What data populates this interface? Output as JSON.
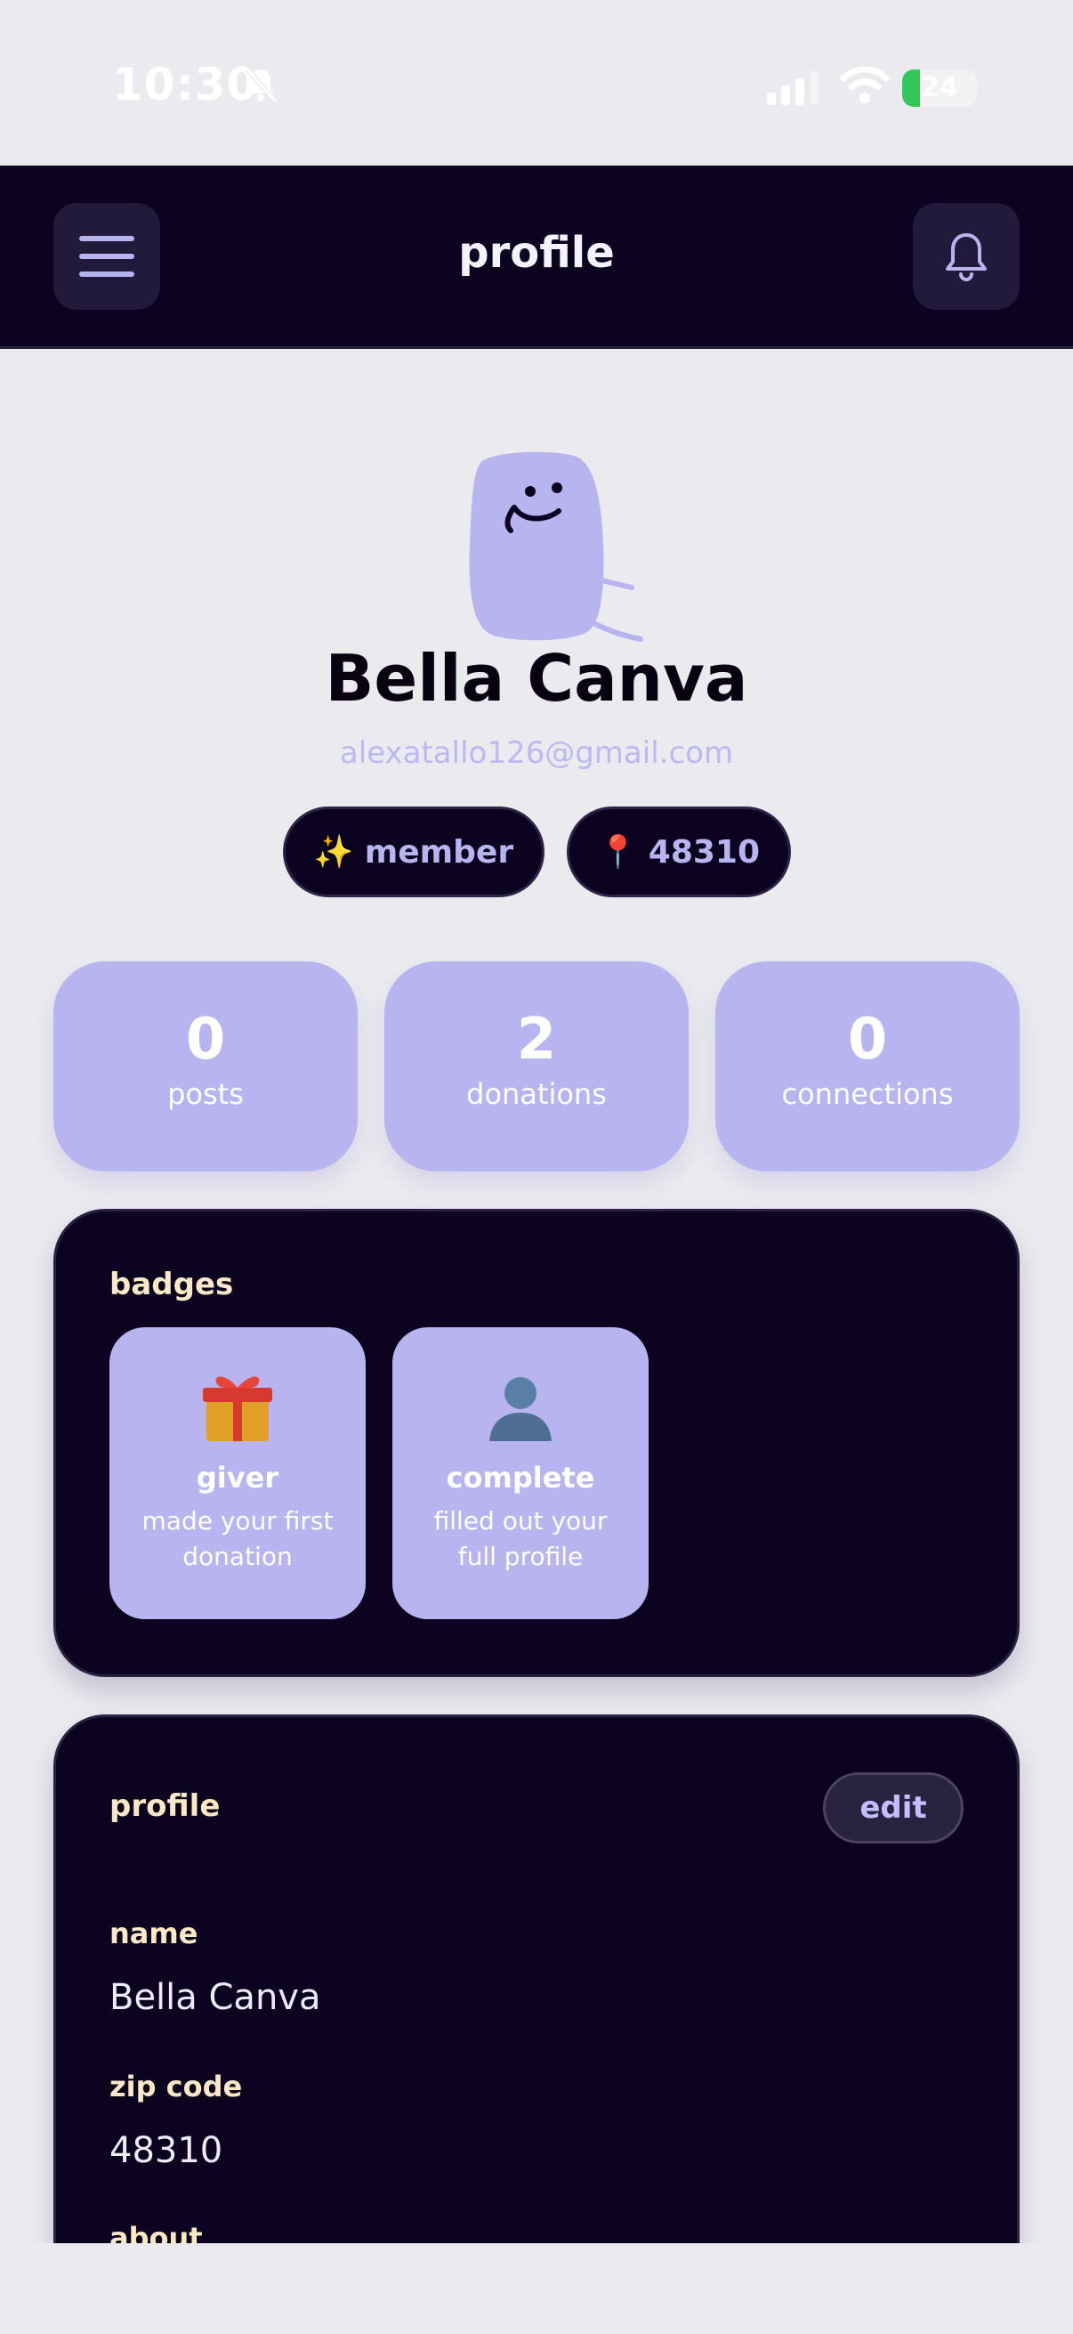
{
  "status_bar": {
    "time": "10:30",
    "battery": "24",
    "battery_level": 0.24
  },
  "header": {
    "title": "profile",
    "menu_icon": "hamburger-icon",
    "notification_icon": "bell-icon"
  },
  "profile": {
    "name": "Bella Canva",
    "email": "alexatallo126@gmail.com",
    "chips": {
      "member_icon": "✨",
      "member_label": "member",
      "zip_icon": "📍",
      "zip_label": "48310"
    }
  },
  "stats": [
    {
      "value": "0",
      "label": "posts"
    },
    {
      "value": "2",
      "label": "donations"
    },
    {
      "value": "0",
      "label": "connections"
    }
  ],
  "badges": {
    "title": "badges",
    "items": [
      {
        "icon": "gift-icon",
        "name": "giver",
        "description": "made your first donation"
      },
      {
        "icon": "person-silhouette-icon",
        "name": "complete",
        "description": "filled out your full profile"
      }
    ]
  },
  "profile_card": {
    "title": "profile",
    "edit_label": "edit",
    "fields": [
      {
        "label": "name",
        "value": "Bella Canva"
      },
      {
        "label": "zip code",
        "value": "48310"
      },
      {
        "label": "about",
        "value": ""
      }
    ]
  },
  "colors": {
    "dark": "#0b0320",
    "lavender": "#b7b4ef",
    "cream_label": "#fbe9c6",
    "background": "#ebebef"
  }
}
